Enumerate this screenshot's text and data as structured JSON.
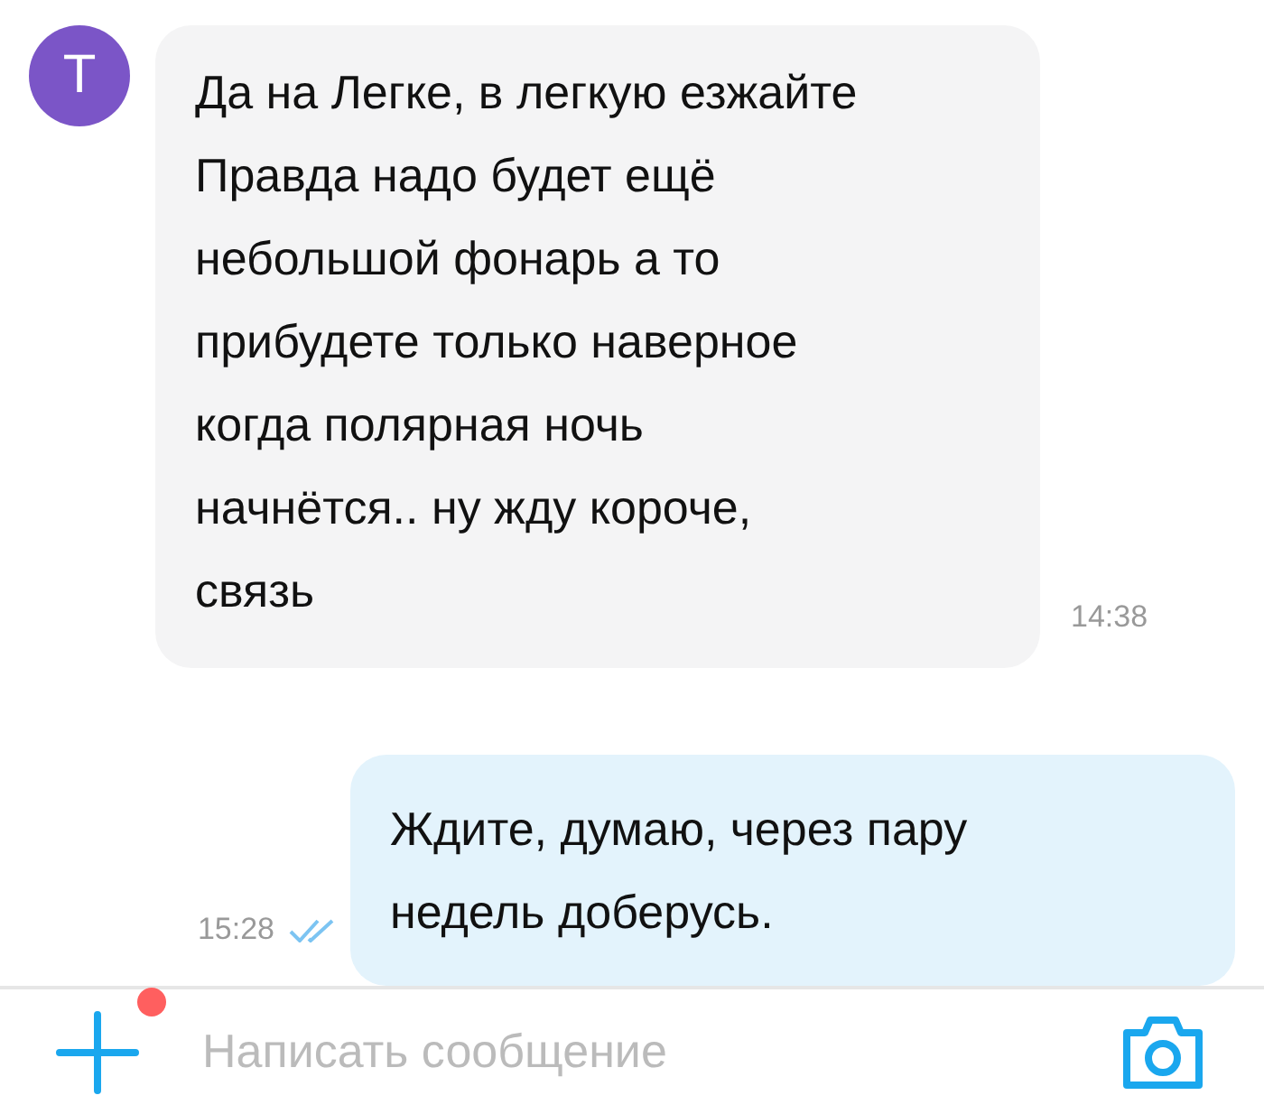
{
  "messages": [
    {
      "kind": "incoming",
      "avatar": "Т",
      "text": "Да на Легке, в легкую езжайте\nПравда надо будет ещё\nнебольшой фонарь а то\nприбудете только наверное\nкогда полярная ночь\nначнётся.. ну жду короче,\nсвязь",
      "time": "14:38"
    },
    {
      "kind": "outgoing",
      "text": "Ждите, думаю, через пару\nнедель доберусь.",
      "time": "15:28",
      "read": true
    }
  ],
  "composer": {
    "placeholder": "Написать сообщение",
    "attach_notification": true
  }
}
